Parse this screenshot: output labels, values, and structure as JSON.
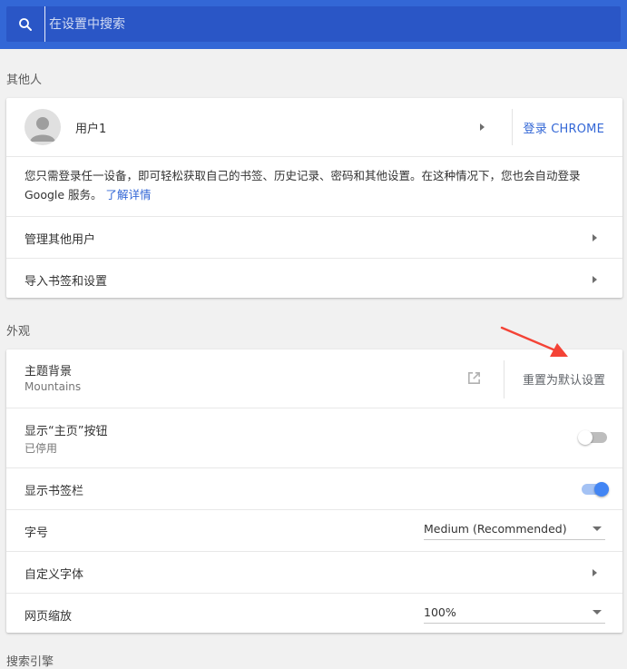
{
  "search": {
    "placeholder": "在设置中搜索"
  },
  "people": {
    "section_title": "其他人",
    "profile_name": "用户1",
    "signin_label": "登录 CHROME",
    "description": "您只需登录任一设备，即可轻松获取自己的书签、历史记录、密码和其他设置。在这种情况下，您也会自动登录 Google 服务。",
    "learn_more": "了解详情",
    "manage_others": "管理其他用户",
    "import_label": "导入书签和设置"
  },
  "appearance": {
    "section_title": "外观",
    "theme_label": "主题背景",
    "theme_value": "Mountains",
    "reset_label": "重置为默认设置",
    "home_button_label": "显示“主页”按钮",
    "home_button_status": "已停用",
    "home_button_enabled": false,
    "bookmarks_bar_label": "显示书签栏",
    "bookmarks_bar_enabled": true,
    "font_size_label": "字号",
    "font_size_value": "Medium (Recommended)",
    "customize_fonts_label": "自定义字体",
    "zoom_label": "网页缩放",
    "zoom_value": "100%"
  },
  "next_section_title": "搜索引擎",
  "colors": {
    "accent": "#3367d6",
    "toolbar": "#3367d6",
    "search_bg": "#2a56c6",
    "toggle_on": "#4285f4",
    "arrow_annotation": "#f44336"
  }
}
